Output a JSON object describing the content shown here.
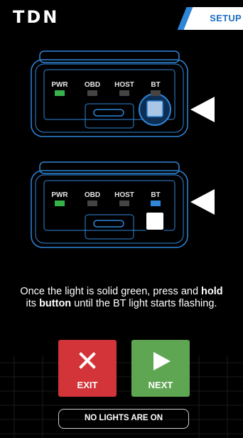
{
  "header": {
    "logo": "TDN",
    "tab_label": "SETUP"
  },
  "device_top": {
    "leds": [
      {
        "label": "PWR",
        "color": "#35b34a"
      },
      {
        "label": "OBD",
        "color": "#4a4a4a"
      },
      {
        "label": "HOST",
        "color": "#4a4a4a"
      },
      {
        "label": "BT",
        "color": "#4a4a4a"
      }
    ]
  },
  "device_bottom": {
    "leds": [
      {
        "label": "PWR",
        "color": "#35b34a"
      },
      {
        "label": "OBD",
        "color": "#4a4a4a"
      },
      {
        "label": "HOST",
        "color": "#4a4a4a"
      },
      {
        "label": "BT",
        "color": "#2f86d8"
      }
    ]
  },
  "instruction": {
    "part1": "Once the light is solid green, press and ",
    "bold1": "hold",
    "part2": " its ",
    "bold2": "button",
    "part3": " until the BT light starts flashing."
  },
  "buttons": {
    "exit": "EXIT",
    "next": "NEXT",
    "no_lights": "NO LIGHTS ARE ON"
  },
  "colors": {
    "accent": "#2f86d8",
    "exit": "#d3343a",
    "next": "#5fa653"
  }
}
